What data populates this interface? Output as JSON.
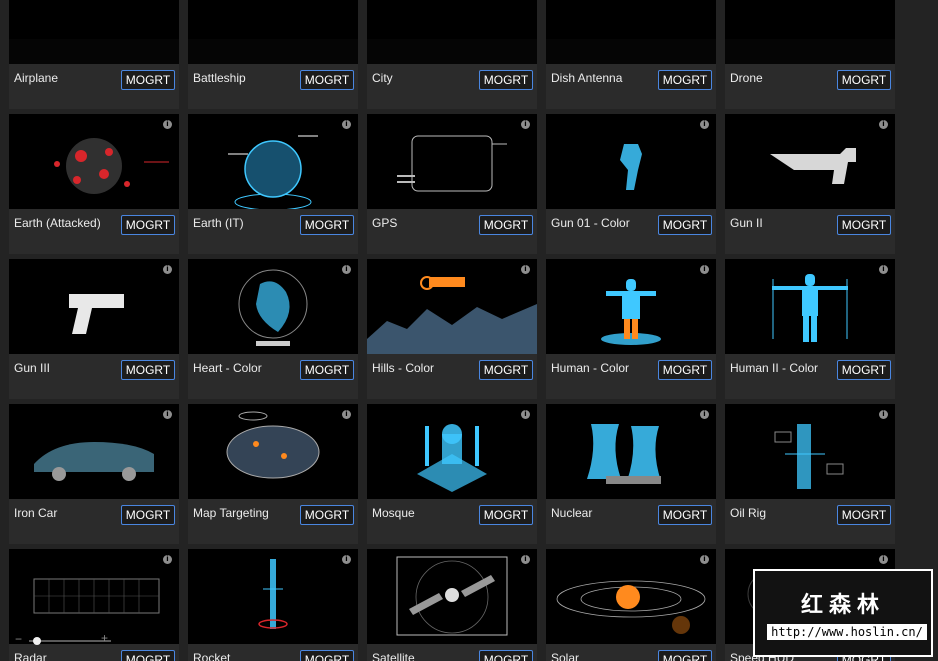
{
  "cards": [
    {
      "label": "Airplane",
      "button": "MOGRT",
      "thumb": "airplane"
    },
    {
      "label": "Battleship",
      "button": "MOGRT",
      "thumb": "battleship"
    },
    {
      "label": "City",
      "button": "MOGRT",
      "thumb": "city"
    },
    {
      "label": "Dish Antenna",
      "button": "MOGRT",
      "thumb": "dish"
    },
    {
      "label": "Drone",
      "button": "MOGRT",
      "thumb": "drone"
    },
    {
      "label": "Earth (Attacked)",
      "button": "MOGRT",
      "thumb": "earth-attacked"
    },
    {
      "label": "Earth (IT)",
      "button": "MOGRT",
      "thumb": "earth-it"
    },
    {
      "label": "GPS",
      "button": "MOGRT",
      "thumb": "gps"
    },
    {
      "label": "Gun 01 - Color",
      "button": "MOGRT",
      "thumb": "gun01"
    },
    {
      "label": "Gun II",
      "button": "MOGRT",
      "thumb": "gun2"
    },
    {
      "label": "Gun III",
      "button": "MOGRT",
      "thumb": "gun3"
    },
    {
      "label": "Heart - Color",
      "button": "MOGRT",
      "thumb": "heart"
    },
    {
      "label": "Hills - Color",
      "button": "MOGRT",
      "thumb": "hills"
    },
    {
      "label": "Human - Color",
      "button": "MOGRT",
      "thumb": "human"
    },
    {
      "label": "Human II - Color",
      "button": "MOGRT",
      "thumb": "human2"
    },
    {
      "label": "Iron Car",
      "button": "MOGRT",
      "thumb": "car"
    },
    {
      "label": "Map Targeting",
      "button": "MOGRT",
      "thumb": "map"
    },
    {
      "label": "Mosque",
      "button": "MOGRT",
      "thumb": "mosque"
    },
    {
      "label": "Nuclear",
      "button": "MOGRT",
      "thumb": "nuclear"
    },
    {
      "label": "Oil Rig",
      "button": "MOGRT",
      "thumb": "oilrig"
    },
    {
      "label": "Radar",
      "button": "MOGRT",
      "thumb": "radar"
    },
    {
      "label": "Rocket",
      "button": "MOGRT",
      "thumb": "rocket"
    },
    {
      "label": "Satellite",
      "button": "MOGRT",
      "thumb": "satellite"
    },
    {
      "label": "Solar",
      "button": "MOGRT",
      "thumb": "solar"
    },
    {
      "label": "Speed HUD",
      "button": "MOGRT",
      "thumb": "speedhud"
    }
  ],
  "info_glyph": "i",
  "zoom": {
    "minus": "−",
    "plus": "+",
    "level": 0.05
  },
  "watermark": {
    "title": "红森林",
    "url": "http://www.hoslin.cn/"
  },
  "colors": {
    "accent": "#4a86e0",
    "cyan": "#3fc8ff",
    "red": "#d8262b",
    "orange": "#ff8a1e"
  }
}
